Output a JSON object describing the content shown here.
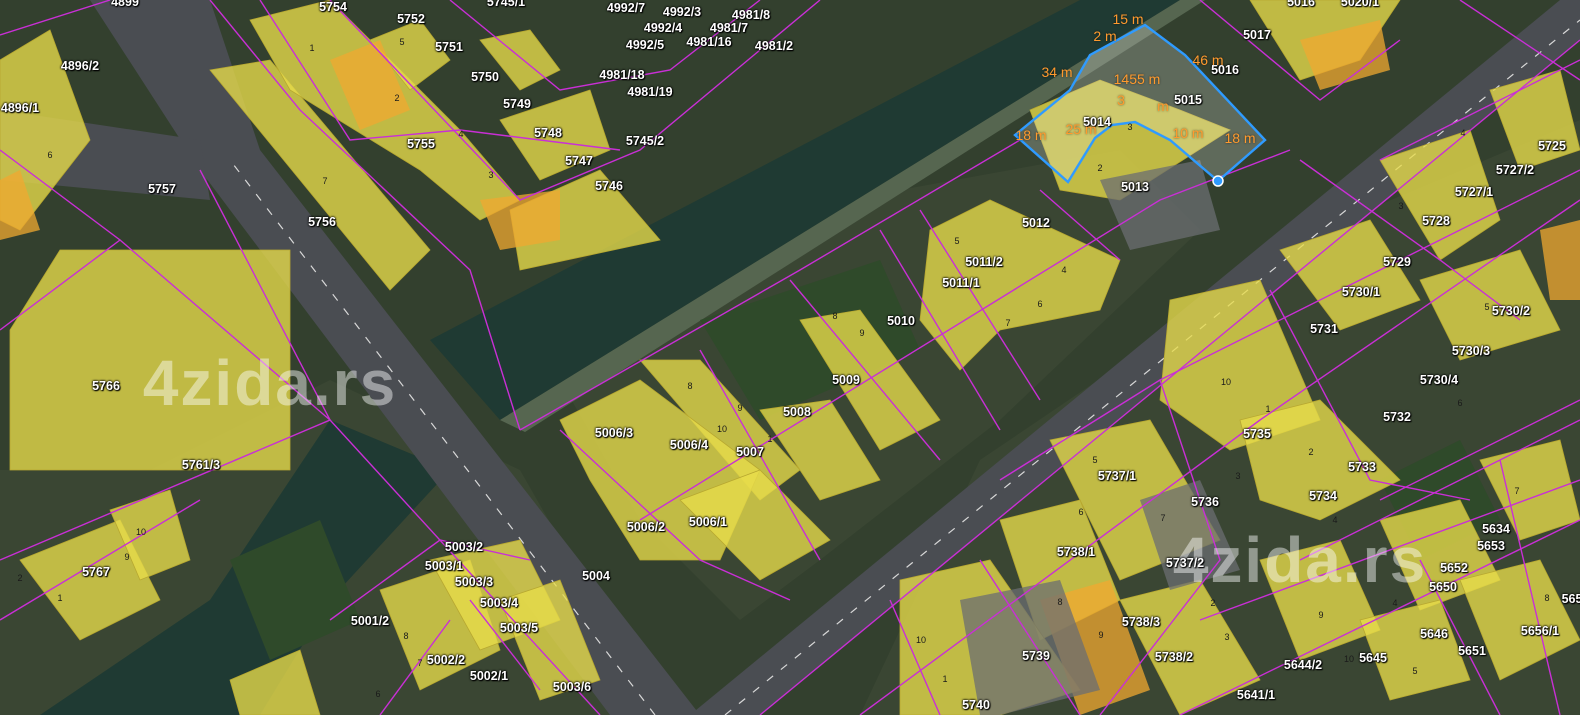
{
  "map": {
    "colors": {
      "parcel_line": "#c92fd6",
      "building": "#e8dc4a",
      "building_orange": "#f0a830",
      "selection": "#2f9bff",
      "measurement": "#ff9a2e",
      "river": "#1f3a33",
      "road": "#4a4d52",
      "green": "#2f4a2a"
    },
    "watermarks": [
      "4zida.rs",
      "4zida.rs"
    ],
    "selection": {
      "measurements": [
        "15 m",
        "2 m",
        "34 m",
        "1455 m",
        "46 m",
        "3",
        "m",
        "18 m",
        "25 m",
        "10 m",
        "18 m"
      ],
      "vertex_icon": "selected-vertex-icon"
    },
    "parcels": [
      "4899",
      "5754",
      "5752",
      "5745/1",
      "4992/7",
      "4992/3",
      "4981/8",
      "4992/4",
      "4981/7",
      "4992/5",
      "4981/16",
      "4981/2",
      "5016",
      "5020/1",
      "5017",
      "4896/2",
      "4896/1",
      "5751",
      "5750",
      "4981/18",
      "4981/19",
      "5016",
      "5015",
      "5014",
      "5749",
      "5748",
      "5745/2",
      "5755",
      "5747",
      "5757",
      "5746",
      "5013",
      "5727/2",
      "5725",
      "5727/1",
      "5728",
      "5756",
      "5012",
      "5011/2",
      "5011/1",
      "5729",
      "5730/1",
      "5730/2",
      "5010",
      "5731",
      "5766",
      "5009",
      "5730/3",
      "5730/4",
      "5732",
      "5008",
      "5006/3",
      "5006/4",
      "5007",
      "5735",
      "5761/3",
      "5733",
      "5737/1",
      "5734",
      "5736",
      "5634",
      "5653",
      "5006/2",
      "5006/1",
      "5767",
      "5738/1",
      "5737/2",
      "5652",
      "5650",
      "5003/2",
      "5003/1",
      "5003/3",
      "5004",
      "5003/4",
      "5738/3",
      "5003/5",
      "5001/2",
      "5646",
      "5656/1",
      "5002/2",
      "5739",
      "5738/2",
      "5645",
      "5644/2",
      "5651",
      "5002/1",
      "5003/6",
      "5641/1",
      "5740",
      "565"
    ],
    "building_numbers": [
      "1",
      "2",
      "3",
      "4",
      "5",
      "6",
      "7",
      "8",
      "9",
      "10"
    ]
  }
}
